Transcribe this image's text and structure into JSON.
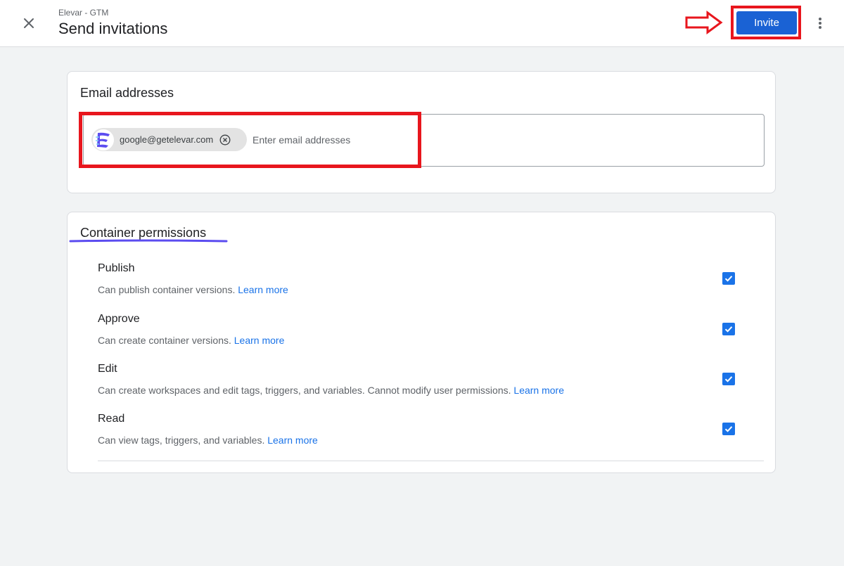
{
  "header": {
    "subtitle": "Elevar - GTM",
    "title": "Send invitations",
    "invite_label": "Invite",
    "close_icon": "close-icon",
    "more_icon": "more-vert-icon"
  },
  "email_card": {
    "title": "Email addresses",
    "chips": [
      {
        "email": "google@getelevar.com",
        "avatar_icon": "elevar-logo-icon"
      }
    ],
    "input_placeholder": "Enter email addresses",
    "input_value": ""
  },
  "permissions_card": {
    "title": "Container permissions",
    "items": [
      {
        "name": "Publish",
        "description": "Can publish container versions.",
        "link": "Learn more",
        "checked": true
      },
      {
        "name": "Approve",
        "description": "Can create container versions.",
        "link": "Learn more",
        "checked": true
      },
      {
        "name": "Edit",
        "description": "Can create workspaces and edit tags, triggers, and variables. Cannot modify user permissions.",
        "link": "Learn more",
        "checked": true
      },
      {
        "name": "Read",
        "description": "Can view tags, triggers, and variables.",
        "link": "Learn more",
        "checked": true
      }
    ]
  },
  "colors": {
    "accent": "#1a73e8",
    "invite_button": "#1a62d4",
    "annotation_red": "#e8161d",
    "annotation_underline": "#5b4cf0"
  }
}
